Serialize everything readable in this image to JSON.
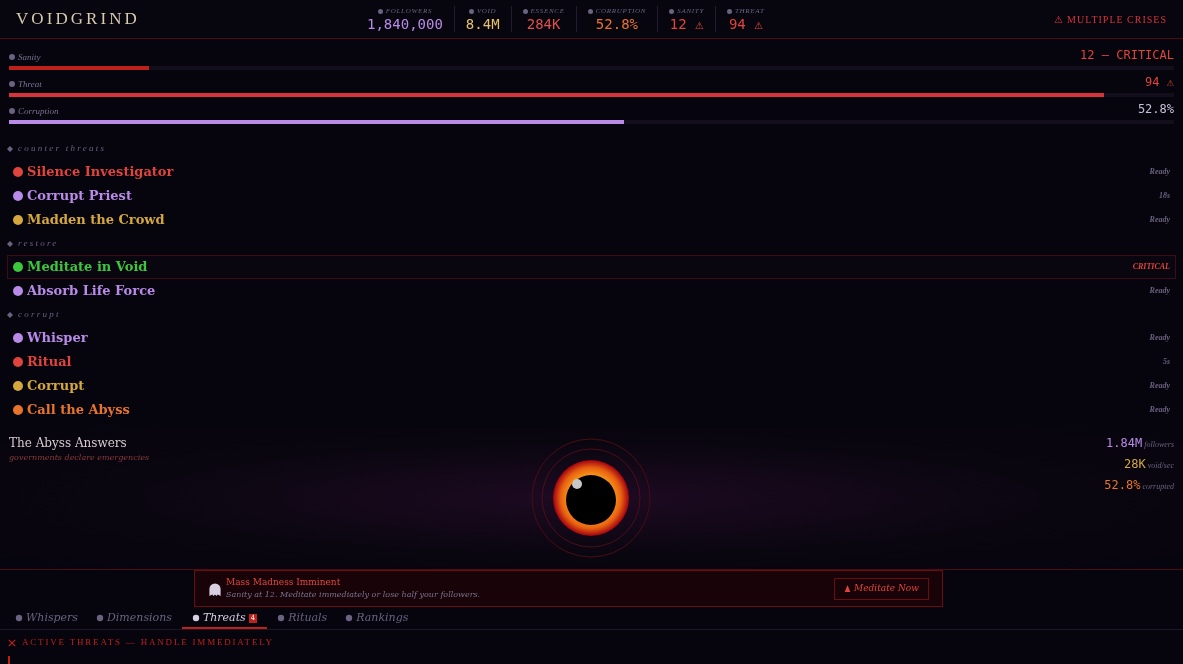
{
  "header": {
    "title": "VOIDGRIND",
    "stats": [
      {
        "label": "FOLLOWERS",
        "value": "1,840,000",
        "color": "#b98ae8"
      },
      {
        "label": "VOID",
        "value": "8.4M",
        "color": "#e6c46a"
      },
      {
        "label": "ESSENCE",
        "value": "284K",
        "color": "#e0504a"
      },
      {
        "label": "CORRUPTION",
        "value": "52.8%",
        "color": "#e8742a"
      },
      {
        "label": "SANITY",
        "value": "12 ⚠",
        "color": "#e0443c"
      },
      {
        "label": "THREAT",
        "value": "94 ⚠",
        "color": "#e0443c"
      }
    ],
    "alert": "⚠ MULTIPLE CRISES"
  },
  "meters": [
    {
      "label": "Sanity",
      "reading": "12 — CRITICAL",
      "level": 0.12,
      "color": "#c0201c",
      "critical": true
    },
    {
      "label": "Threat",
      "reading": "94 ⚠",
      "level": 0.94,
      "color": "#d8333a",
      "critical": true
    },
    {
      "label": "Corruption",
      "reading": "52.8%",
      "level": 0.528,
      "color": "#b98ae8",
      "critical": false
    }
  ],
  "sections": [
    {
      "title": "counter threats",
      "actions": [
        {
          "name": "Silence Investigator",
          "status": "Ready",
          "color": "#e0443c",
          "critical": false
        },
        {
          "name": "Corrupt Priest",
          "status": "18s",
          "color": "#b98ae8",
          "critical": false
        },
        {
          "name": "Madden the Crowd",
          "status": "Ready",
          "color": "#d4a83c",
          "critical": false
        }
      ]
    },
    {
      "title": "restore",
      "actions": [
        {
          "name": "Meditate in Void",
          "status": "CRITICAL",
          "color": "#3cc83c",
          "critical": true
        },
        {
          "name": "Absorb Life Force",
          "status": "Ready",
          "color": "#b98ae8",
          "critical": false
        }
      ]
    },
    {
      "title": "corrupt",
      "actions": [
        {
          "name": "Whisper",
          "status": "Ready",
          "color": "#b98ae8",
          "critical": false
        },
        {
          "name": "Ritual",
          "status": "5s",
          "color": "#e0443c",
          "critical": false
        },
        {
          "name": "Corrupt",
          "status": "Ready",
          "color": "#d4a83c",
          "critical": false
        },
        {
          "name": "Call the Abyss",
          "status": "Ready",
          "color": "#e8742a",
          "critical": false
        }
      ]
    }
  ],
  "abyss": {
    "title": "The Abyss Answers",
    "subtitle": "governments declare emergencies",
    "stats": [
      {
        "value": "1.84M",
        "unit": "followers",
        "color": "#b98ae8"
      },
      {
        "value": "28K",
        "unit": "void/sec",
        "color": "#d4a83c"
      },
      {
        "value": "52.8%",
        "unit": "corrupted",
        "color": "#e8742a"
      }
    ]
  },
  "notification": {
    "title": "Mass Madness Imminent",
    "message": "Sanity at 12. Meditate immediately or lose half your followers.",
    "button": "Meditate Now"
  },
  "tabs": [
    {
      "label": "Whispers",
      "selected": false
    },
    {
      "label": "Dimensions",
      "selected": false
    },
    {
      "label": "Threats",
      "selected": true,
      "badge": "4"
    },
    {
      "label": "Rituals",
      "selected": false
    },
    {
      "label": "Rankings",
      "selected": false
    }
  ],
  "panel": {
    "heading": "ACTIVE THREATS — HANDLE IMMEDIATELY"
  }
}
